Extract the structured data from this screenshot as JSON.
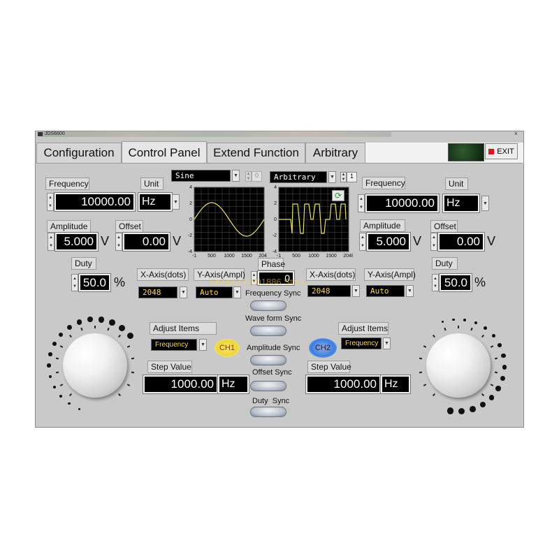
{
  "window": {
    "title": "JDS6600",
    "exit_label": "EXIT"
  },
  "tabs": [
    {
      "label": "Configuration"
    },
    {
      "label": "Control Panel"
    },
    {
      "label": "Extend Function"
    },
    {
      "label": "Arbitrary"
    }
  ],
  "ch1": {
    "frequency_label": "Frequency",
    "frequency_value": "10000.00",
    "unit_label": "Unit",
    "unit_value": "Hz",
    "amplitude_label": "Amplitude",
    "amplitude_value": "5.000",
    "amplitude_unit": "V",
    "offset_label": "Offset",
    "offset_value": "0.00",
    "offset_unit": "V",
    "duty_label": "Duty",
    "duty_value": "50.0",
    "duty_unit": "%",
    "waveform": "Sine",
    "waveform_index": "0",
    "x_axis_label": "X-Axis(dots)",
    "x_axis_value": "2048",
    "y_axis_label": "Y-Axis(Ampl)",
    "y_axis_value": "Auto",
    "adjust_items_label": "Adjust Items",
    "adjust_items_value": "Frequency",
    "badge": "CH1",
    "step_label": "Step Value",
    "step_value": "1000.00",
    "step_unit": "Hz"
  },
  "ch2": {
    "frequency_label": "Frequency",
    "frequency_value": "10000.00",
    "unit_label": "Unit",
    "unit_value": "Hz",
    "amplitude_label": "Amplitude",
    "amplitude_value": "5.000",
    "amplitude_unit": "V",
    "offset_label": "Offset",
    "offset_value": "0.00",
    "offset_unit": "V",
    "duty_label": "Duty",
    "duty_value": "50.0",
    "duty_unit": "%",
    "waveform": "Arbitrary",
    "waveform_index": "1",
    "x_axis_label": "X-Axis(dots)",
    "x_axis_value": "2048",
    "y_axis_label": "Y-Axis(Ampl)",
    "y_axis_value": "Auto",
    "adjust_items_label": "Adjust Items",
    "adjust_items_value": "Frequency",
    "badge": "CH2",
    "step_label": "Step Value",
    "step_value": "1000.00",
    "step_unit": "Hz"
  },
  "center": {
    "phase_label": "Phase",
    "phase_value": "0",
    "sync": [
      {
        "label": "Frequency Sync"
      },
      {
        "label": "Wave form Sync"
      },
      {
        "label": "Amplitude Sync"
      },
      {
        "label": "Offset Sync"
      },
      {
        "label": "Duty  Sync"
      }
    ]
  },
  "graph_axes": {
    "y_ticks": [
      "4",
      "2",
      "0",
      "-2",
      "-4"
    ],
    "x_ticks": [
      "-1",
      "500",
      "1000",
      "1500",
      "2048"
    ]
  },
  "watermark": "Shop4347201886 Store",
  "colors": {
    "trace": "#e8e070",
    "grid": "#555555",
    "exit_icon": "#d8141c",
    "ch1_badge": "#f3e03a",
    "ch2_badge": "#3a7fe0"
  },
  "icons": {
    "refresh": "refresh-icon",
    "exit": "exit-icon"
  }
}
